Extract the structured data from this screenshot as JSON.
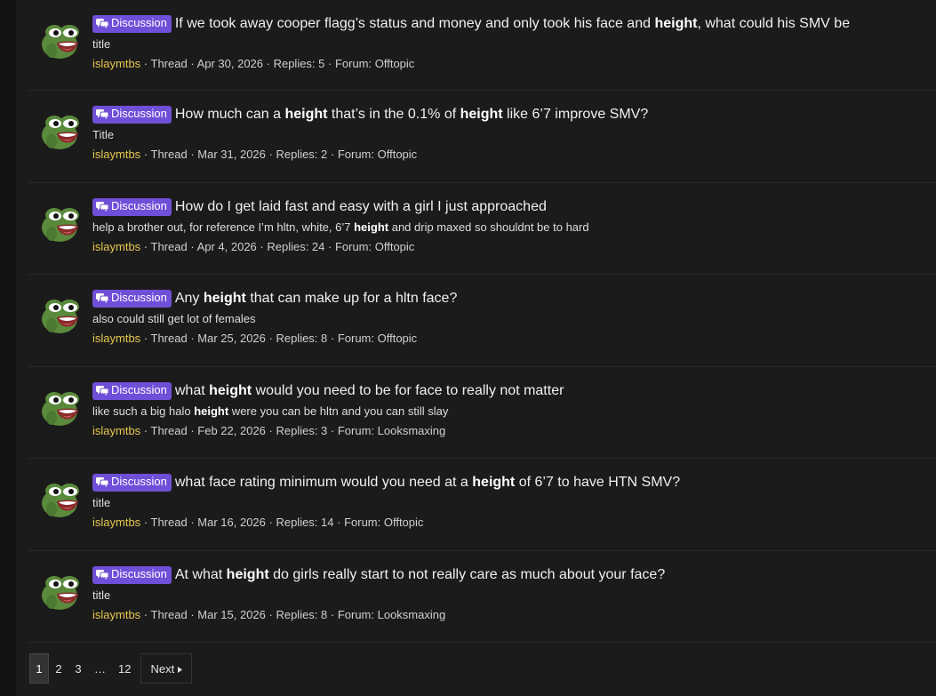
{
  "threads": [
    {
      "badge": "Discussion",
      "title_parts": [
        [
          "If we took away cooper flagg’s status and money and only took his face and ",
          false
        ],
        [
          "height",
          true
        ],
        [
          ", what could his SMV be",
          false
        ]
      ],
      "snippet_parts": [
        [
          "title",
          false
        ]
      ],
      "user": "islaymtbs",
      "type": "Thread",
      "date": "Apr 30, 2026",
      "replies": "Replies: 5",
      "forum": "Forum: Offtopic"
    },
    {
      "badge": "Discussion",
      "title_parts": [
        [
          "How much can a ",
          false
        ],
        [
          "height",
          true
        ],
        [
          " that’s in the 0.1% of ",
          false
        ],
        [
          "height",
          true
        ],
        [
          " like 6’7 improve SMV?",
          false
        ]
      ],
      "snippet_parts": [
        [
          "Title",
          false
        ]
      ],
      "user": "islaymtbs",
      "type": "Thread",
      "date": "Mar 31, 2026",
      "replies": "Replies: 2",
      "forum": "Forum: Offtopic"
    },
    {
      "badge": "Discussion",
      "title_parts": [
        [
          "How do I get laid fast and easy with a girl I just approached",
          false
        ]
      ],
      "snippet_parts": [
        [
          "help a brother out, for reference I’m hltn, white, 6’7 ",
          false
        ],
        [
          "height",
          true
        ],
        [
          " and drip maxed so shouldnt be to hard",
          false
        ]
      ],
      "user": "islaymtbs",
      "type": "Thread",
      "date": "Apr 4, 2026",
      "replies": "Replies: 24",
      "forum": "Forum: Offtopic"
    },
    {
      "badge": "Discussion",
      "title_parts": [
        [
          "Any ",
          false
        ],
        [
          "height",
          true
        ],
        [
          " that can make up for a hltn face?",
          false
        ]
      ],
      "snippet_parts": [
        [
          "also could still get lot of females",
          false
        ]
      ],
      "user": "islaymtbs",
      "type": "Thread",
      "date": "Mar 25, 2026",
      "replies": "Replies: 8",
      "forum": "Forum: Offtopic"
    },
    {
      "badge": "Discussion",
      "title_parts": [
        [
          "what ",
          false
        ],
        [
          "height",
          true
        ],
        [
          " would you need to be for face to really not matter",
          false
        ]
      ],
      "snippet_parts": [
        [
          "like such a big halo ",
          false
        ],
        [
          "height",
          true
        ],
        [
          " were you can be hltn and you can still slay",
          false
        ]
      ],
      "user": "islaymtbs",
      "type": "Thread",
      "date": "Feb 22, 2026",
      "replies": "Replies: 3",
      "forum": "Forum: Looksmaxing"
    },
    {
      "badge": "Discussion",
      "title_parts": [
        [
          "what face rating minimum would you need at a ",
          false
        ],
        [
          "height",
          true
        ],
        [
          " of 6’7 to have HTN SMV?",
          false
        ]
      ],
      "snippet_parts": [
        [
          "title",
          false
        ]
      ],
      "user": "islaymtbs",
      "type": "Thread",
      "date": "Mar 16, 2026",
      "replies": "Replies: 14",
      "forum": "Forum: Offtopic"
    },
    {
      "badge": "Discussion",
      "title_parts": [
        [
          "At what ",
          false
        ],
        [
          "height",
          true
        ],
        [
          " do girls really start to not really care as much about your face?",
          false
        ]
      ],
      "snippet_parts": [
        [
          "title",
          false
        ]
      ],
      "user": "islaymtbs",
      "type": "Thread",
      "date": "Mar 15, 2026",
      "replies": "Replies: 8",
      "forum": "Forum: Looksmaxing"
    }
  ],
  "separator": " · ",
  "pagination": {
    "pages": [
      "1",
      "2",
      "3",
      "…",
      "12"
    ],
    "current": "1",
    "next_label": "Next",
    "next_icon": "caret-right-icon"
  },
  "colors": {
    "background": "#1b1b1b",
    "badge": "#6f4fd8",
    "username": "#e6c84d"
  }
}
